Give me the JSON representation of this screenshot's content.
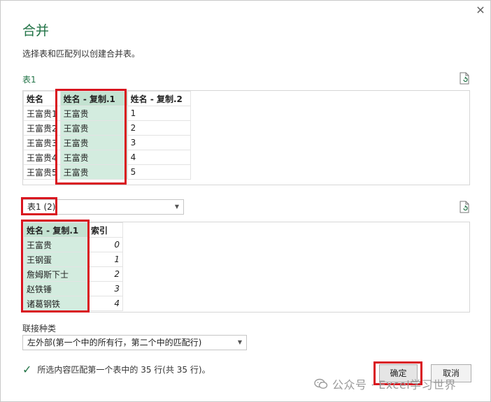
{
  "dialog": {
    "close_glyph": "✕",
    "title": "合并",
    "subtitle": "选择表和匹配列以创建合并表。"
  },
  "table1": {
    "label": "表1",
    "headers": [
      "姓名",
      "姓名 - 复制.1",
      "姓名 - 复制.2"
    ],
    "rows": [
      [
        "王富贵1",
        "王富贵",
        "1"
      ],
      [
        "王富贵2",
        "王富贵",
        "2"
      ],
      [
        "王富贵3",
        "王富贵",
        "3"
      ],
      [
        "王富贵4",
        "王富贵",
        "4"
      ],
      [
        "王富贵5",
        "王富贵",
        "5"
      ]
    ]
  },
  "table2": {
    "selected": "表1 (2)",
    "headers": [
      "姓名 - 复制.1",
      "索引"
    ],
    "rows": [
      [
        "王富贵",
        "0"
      ],
      [
        "王钢蛋",
        "1"
      ],
      [
        "詹姆斯下士",
        "2"
      ],
      [
        "赵铁锤",
        "3"
      ],
      [
        "诸葛钢铁",
        "4"
      ]
    ]
  },
  "join": {
    "label": "联接种类",
    "selected": "左外部(第一个中的所有行，第二个中的匹配行)"
  },
  "status": {
    "text": "所选内容匹配第一个表中的 35 行(共 35 行)。"
  },
  "buttons": {
    "ok": "确定",
    "cancel": "取消"
  },
  "watermark": {
    "text": "公众号 · Excel学习世界"
  },
  "colors": {
    "accent": "#217346",
    "highlight": "#d3ecdf",
    "annotation": "#d9151f"
  }
}
